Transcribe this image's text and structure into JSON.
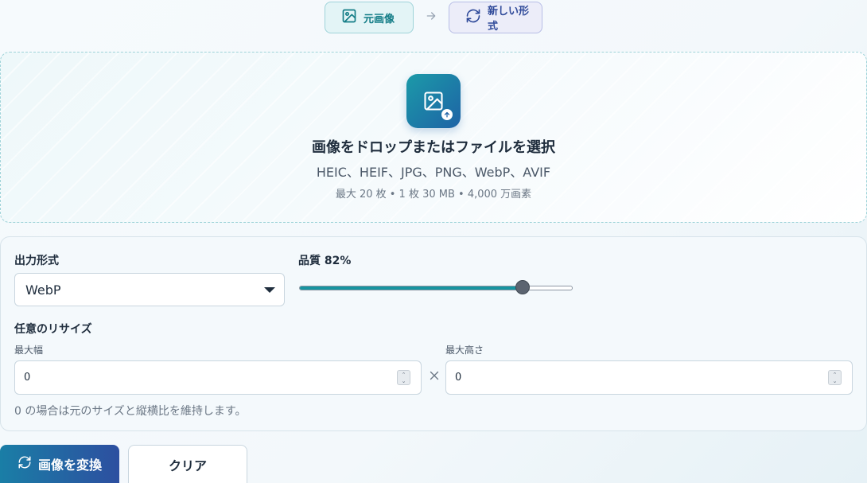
{
  "steps": {
    "original_label": "元画像",
    "original_icon": "image-icon",
    "arrow_icon": "arrow-right-icon",
    "new_label": "新しい形式",
    "new_icon": "refresh-icon"
  },
  "dropzone": {
    "icon": "image-upload-icon",
    "title": "画像をドロップまたはファイルを選択",
    "formats": "HEIC、HEIF、JPG、PNG、WebP、AVIF",
    "limits": "最大 20 枚 • 1 枚 30 MB • 4,000 万画素"
  },
  "settings": {
    "format_label": "出力形式",
    "format_value": "WebP",
    "quality_label": "品質 82%",
    "quality_value": 82,
    "resize_label": "任意のリサイズ",
    "max_width_label": "最大幅",
    "max_width_value": "0",
    "max_height_label": "最大高さ",
    "max_height_value": "0",
    "hint": "0 の場合は元のサイズと縦横比を維持します。"
  },
  "actions": {
    "convert_label": "画像を変換",
    "convert_icon": "refresh-icon",
    "clear_label": "クリア"
  },
  "colors": {
    "accent": "#1794a0",
    "primary_gradient_start": "#1a7ea6",
    "primary_gradient_end": "#2d4fa0"
  }
}
